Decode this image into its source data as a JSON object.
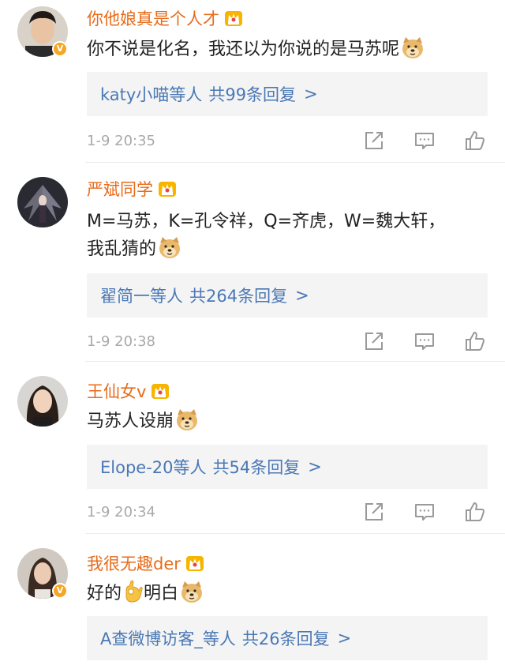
{
  "comments": [
    {
      "username": "你他娘真是个人才",
      "text": "你不说是化名，我还以为你说的是马苏呢",
      "reply": {
        "users": "katy小喵等人",
        "count": "共99条回复",
        "chevron": ">"
      },
      "time": "1-9 20:35",
      "verified": true
    },
    {
      "username": "严斌同学",
      "text_line1": "M=马苏，K=孔令祥，Q=齐虎，W=魏大轩，",
      "text_line2": "我乱猜的",
      "reply": {
        "users": "翟简一等人",
        "count": "共264条回复",
        "chevron": ">"
      },
      "time": "1-9 20:38",
      "verified": false
    },
    {
      "username": "王仙女v",
      "text": "马苏人设崩",
      "reply": {
        "users": "Elope-20等人",
        "count": "共54条回复",
        "chevron": ">"
      },
      "time": "1-9 20:34",
      "verified": false
    },
    {
      "username": "我很无趣der",
      "text_a": "好的",
      "text_b": "明白",
      "reply": {
        "users": "A查微博访客_等人",
        "count": "共26条回复",
        "chevron": ">"
      },
      "verified": true
    }
  ],
  "colors": {
    "username": "#e86b1a",
    "link": "#4a78b5",
    "time": "#a9a9a9",
    "badge": "#f5a623"
  },
  "icons": [
    "crown-icon",
    "doge-emoji-icon",
    "ok-hand-emoji-icon",
    "share-icon",
    "comment-icon",
    "like-icon",
    "verified-badge-icon"
  ]
}
